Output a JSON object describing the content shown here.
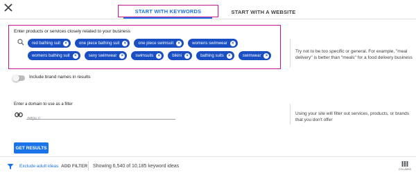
{
  "tabs": {
    "keywords": "START WITH KEYWORDS",
    "website": "START WITH A WEBSITE"
  },
  "keywords": {
    "label": "Enter products or services closely related to your business",
    "chips": [
      [
        "red bathing suit",
        "one piece bathing suit",
        "one piece swimsuit",
        "womens swimwear"
      ],
      [
        "womens bathing suit",
        "sexy swimwear",
        "swimsuits",
        "bikini",
        "bathing suits",
        "swimwear"
      ]
    ],
    "tip": "Try not to be too specific or general. For example, \"meal delivery\" is better than \"meals\" for a food delivery business"
  },
  "brand_toggle": {
    "label": "Include brand names in results",
    "on": false
  },
  "domain_filter": {
    "label": "Enter a domain to use as a filter",
    "placeholder": "https://",
    "value": "",
    "tip": "Using your site will filter out services, products, or brands that you don't offer"
  },
  "get_results": "GET RESULTS",
  "bottom_bar": {
    "exclude_adult": "Exclude adult ideas",
    "add_filter": "ADD FILTER",
    "showing": "Showing 6,540 of 10,185 keyword ideas",
    "columns": "COLUMNS"
  },
  "icons": {
    "close": "close-icon",
    "search": "search-icon",
    "link": "link-icon",
    "filter": "filter-icon",
    "columns": "columns-icon"
  },
  "colors": {
    "accent": "#1a73e8",
    "chip": "#1a4fc4",
    "highlight": "#c2188f"
  }
}
